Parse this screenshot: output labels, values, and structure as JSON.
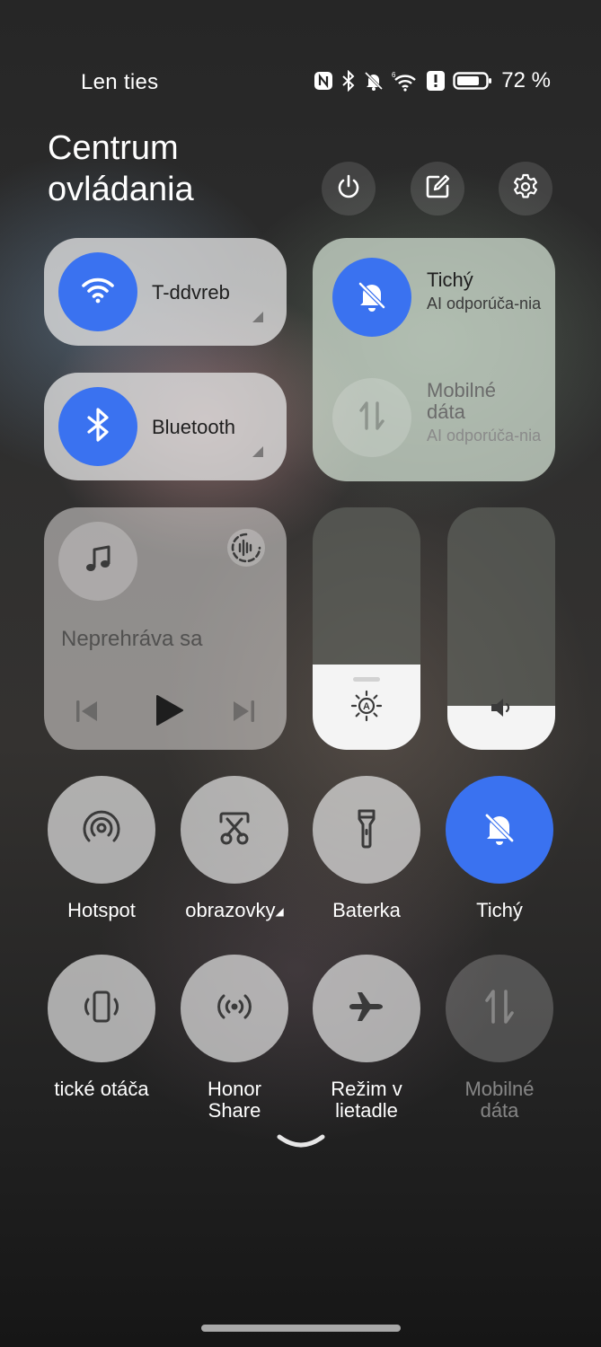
{
  "status_bar": {
    "carrier": "Len ties",
    "battery_percent": "72 %",
    "icons": [
      "nfc-icon",
      "bluetooth-icon",
      "muted-bell-icon",
      "wifi-6-icon",
      "alert-icon",
      "battery-icon"
    ]
  },
  "header": {
    "title": "Centrum ovládania",
    "buttons": [
      "power-icon",
      "edit-icon",
      "gear-icon"
    ]
  },
  "tiles": {
    "wifi": {
      "label": "T-ddvreb"
    },
    "bluetooth": {
      "label": "Bluetooth"
    },
    "sound_mode": {
      "title": "Tichý",
      "subtitle": "AI odporúča-nia"
    },
    "mobile_data": {
      "title": "Mobilné dáta",
      "subtitle": "AI odporúča-nia"
    }
  },
  "media": {
    "status": "Neprehráva sa",
    "controls": [
      "previous-icon",
      "play-icon",
      "next-icon"
    ]
  },
  "sliders": {
    "brightness": {
      "level": 0.35,
      "icon": "auto-brightness-icon"
    },
    "volume": {
      "level": 0.18,
      "icon": "speaker-icon"
    }
  },
  "quick_settings": [
    {
      "label": "Hotspot",
      "icon": "hotspot-icon",
      "state": "off"
    },
    {
      "label": "obrazovky",
      "icon": "screenshot-icon",
      "state": "off"
    },
    {
      "label": "Baterka",
      "icon": "flashlight-icon",
      "state": "off"
    },
    {
      "label": "Tichý",
      "icon": "muted-bell-icon",
      "state": "on"
    },
    {
      "label": "tické otáča",
      "icon": "auto-rotate-icon",
      "state": "off"
    },
    {
      "label": "Honor Share",
      "icon": "honor-share-icon",
      "state": "off"
    },
    {
      "label": "Režim v lietadle",
      "icon": "airplane-icon",
      "state": "off"
    },
    {
      "label": "Mobilné dáta",
      "icon": "mobile-data-icon",
      "state": "disabled"
    }
  ],
  "colors": {
    "accent": "#3a72f0"
  }
}
